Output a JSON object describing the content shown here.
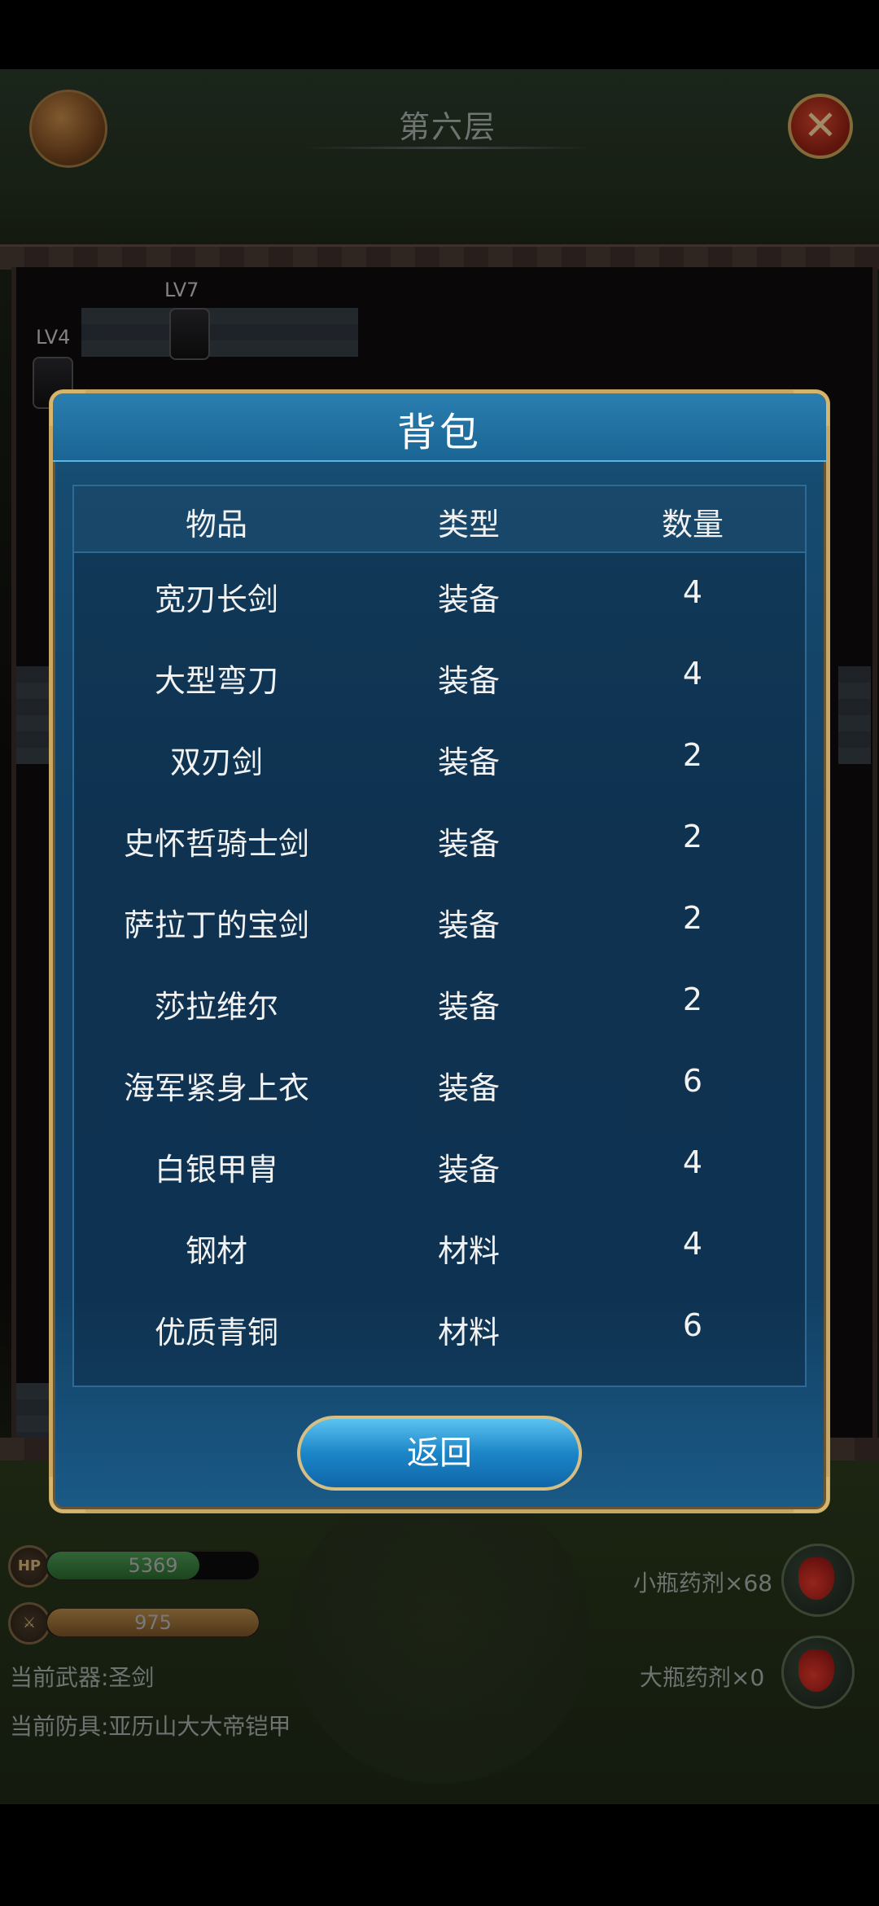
{
  "header": {
    "floor_title": "第六层"
  },
  "map": {
    "labels": [
      "LV7",
      "LV4"
    ]
  },
  "hud": {
    "hp_label": "HP",
    "hp_value": "5369",
    "hp_fill": 0.72,
    "attack_value": "975",
    "attack_fill": 1.0,
    "current_weapon": "当前武器:圣剑",
    "current_armor": "当前防具:亚历山大大帝铠甲",
    "small_potion": "小瓶药剂×68",
    "large_potion": "大瓶药剂×0"
  },
  "modal": {
    "title": "背包",
    "columns": [
      "物品",
      "类型",
      "数量"
    ],
    "rows": [
      {
        "name": "宽刃长剑",
        "type": "装备",
        "qty": "4"
      },
      {
        "name": "大型弯刀",
        "type": "装备",
        "qty": "4"
      },
      {
        "name": "双刃剑",
        "type": "装备",
        "qty": "2"
      },
      {
        "name": "史怀哲骑士剑",
        "type": "装备",
        "qty": "2"
      },
      {
        "name": "萨拉丁的宝剑",
        "type": "装备",
        "qty": "2"
      },
      {
        "name": "莎拉维尔",
        "type": "装备",
        "qty": "2"
      },
      {
        "name": "海军紧身上衣",
        "type": "装备",
        "qty": "6"
      },
      {
        "name": "白银甲胄",
        "type": "装备",
        "qty": "4"
      },
      {
        "name": "钢材",
        "type": "材料",
        "qty": "4"
      },
      {
        "name": "优质青铜",
        "type": "材料",
        "qty": "6"
      }
    ],
    "back_label": "返回"
  },
  "icons": {
    "bag": "backpack-icon",
    "close": "close-icon",
    "hp": "hp-icon",
    "attack": "sword-icon",
    "potion": "potion-icon"
  }
}
